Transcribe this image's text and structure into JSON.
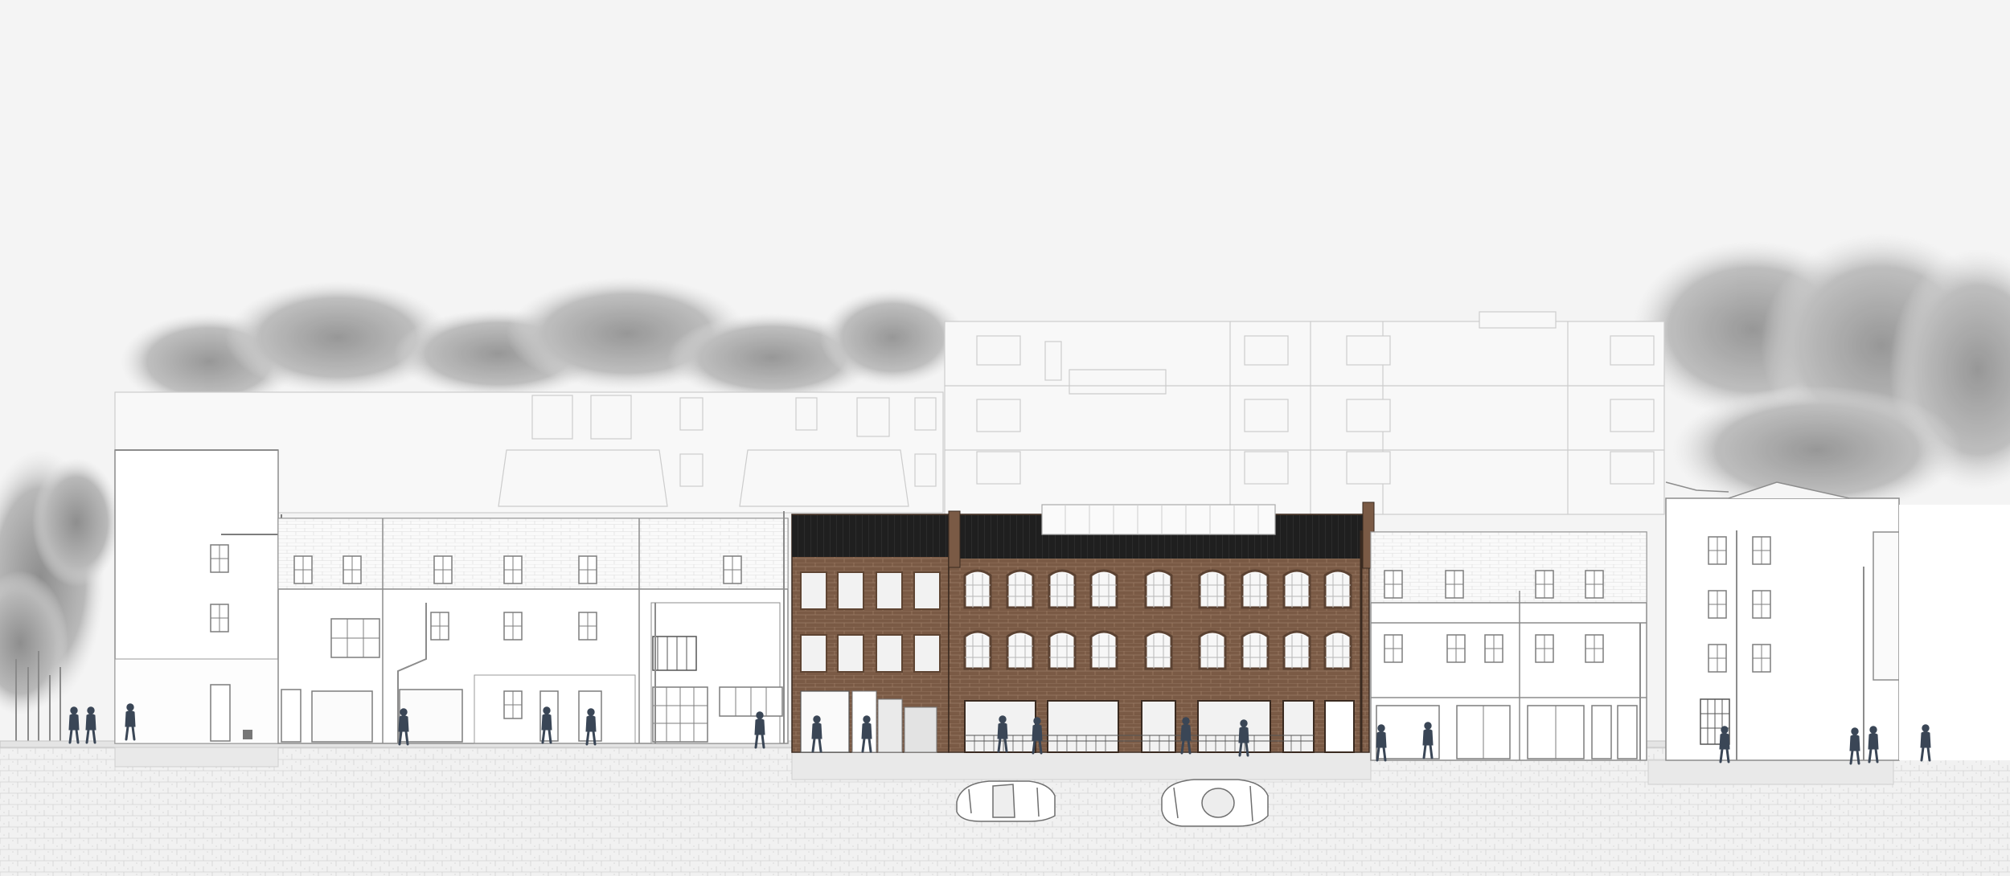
{
  "drawing": {
    "kind": "street elevation",
    "colors": {
      "sky": "#f4f4f4",
      "foliage": "#9a9a9a",
      "foliage_light": "#c8c8c8",
      "background_building_line": "#c9c9c9",
      "neighbour_wall": "#ffffff",
      "neighbour_line": "#8c8c8c",
      "brick": "#7a5a45",
      "brick_dark": "#5e4432",
      "brick_mortar": "#9b7c66",
      "roof": "#1d1d1d",
      "glass": "#e6e6e6",
      "pavement": "#e9e9e9",
      "cobbles_line": "#cfcfcf",
      "figures": "#3a4656"
    },
    "icons": [
      "tree-icon",
      "car-icon",
      "pedestrian-icon"
    ]
  }
}
